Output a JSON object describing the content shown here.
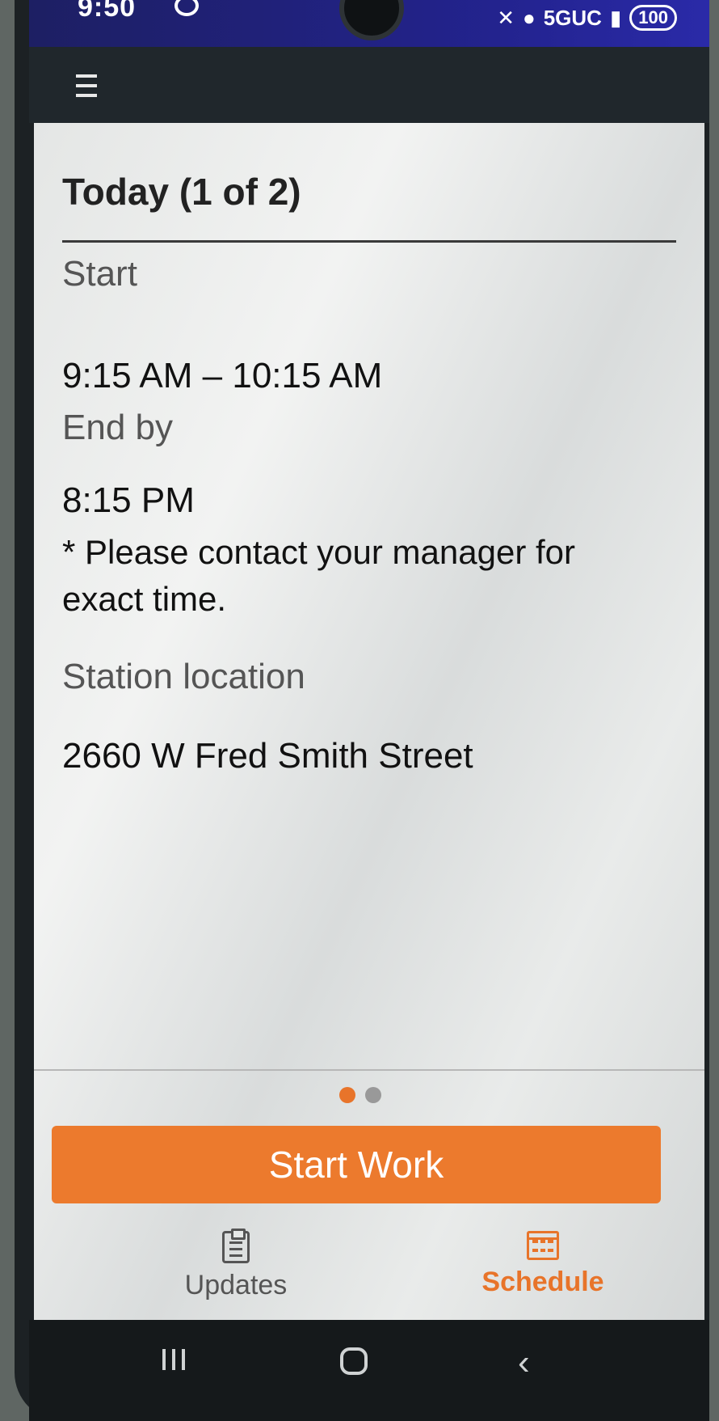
{
  "status_bar": {
    "time": "9:50",
    "network": "5GUC",
    "battery": "100"
  },
  "header": {
    "menu_icon": "hamburger-menu-icon"
  },
  "card": {
    "title": "Today (1 of 2)",
    "start_label": "Start",
    "start_value": "9:15 AM – 10:15 AM",
    "end_label": "End by",
    "end_value": "8:15 PM",
    "note": "* Please contact your manager for exact time.",
    "location_label": "Station location",
    "location_value": "2660 W Fred Smith Street"
  },
  "pager": {
    "total": 2,
    "active_index": 0
  },
  "actions": {
    "start_work_label": "Start Work"
  },
  "bottom_tabs": [
    {
      "label": "Updates",
      "icon": "clipboard-icon",
      "active": false
    },
    {
      "label": "Schedule",
      "icon": "calendar-icon",
      "active": true
    }
  ],
  "colors": {
    "accent": "#EC7A2D",
    "app_bar": "#20272C",
    "status_bar": "#23238F"
  }
}
